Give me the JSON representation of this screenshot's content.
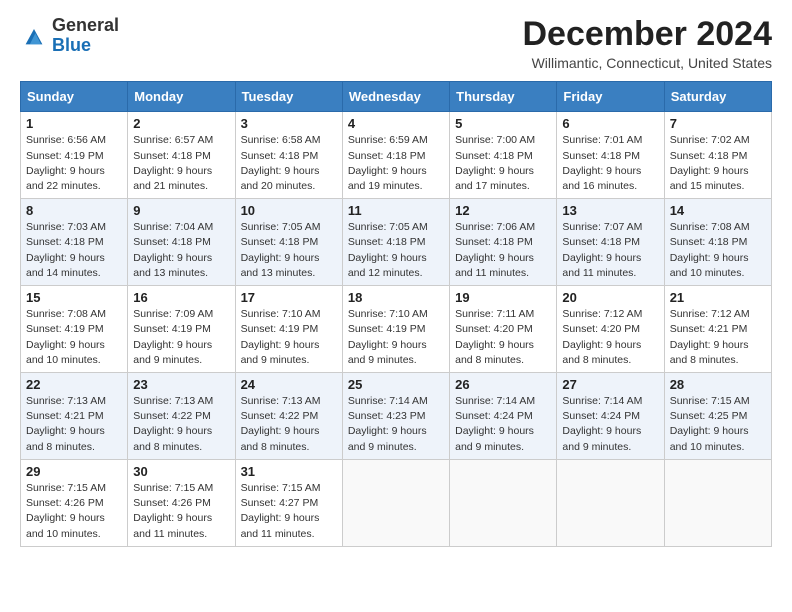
{
  "header": {
    "logo_general": "General",
    "logo_blue": "Blue",
    "month_title": "December 2024",
    "location": "Willimantic, Connecticut, United States"
  },
  "days_of_week": [
    "Sunday",
    "Monday",
    "Tuesday",
    "Wednesday",
    "Thursday",
    "Friday",
    "Saturday"
  ],
  "weeks": [
    [
      {
        "day": 1,
        "sunrise": "6:56 AM",
        "sunset": "4:19 PM",
        "daylight": "9 hours and 22 minutes."
      },
      {
        "day": 2,
        "sunrise": "6:57 AM",
        "sunset": "4:18 PM",
        "daylight": "9 hours and 21 minutes."
      },
      {
        "day": 3,
        "sunrise": "6:58 AM",
        "sunset": "4:18 PM",
        "daylight": "9 hours and 20 minutes."
      },
      {
        "day": 4,
        "sunrise": "6:59 AM",
        "sunset": "4:18 PM",
        "daylight": "9 hours and 19 minutes."
      },
      {
        "day": 5,
        "sunrise": "7:00 AM",
        "sunset": "4:18 PM",
        "daylight": "9 hours and 17 minutes."
      },
      {
        "day": 6,
        "sunrise": "7:01 AM",
        "sunset": "4:18 PM",
        "daylight": "9 hours and 16 minutes."
      },
      {
        "day": 7,
        "sunrise": "7:02 AM",
        "sunset": "4:18 PM",
        "daylight": "9 hours and 15 minutes."
      }
    ],
    [
      {
        "day": 8,
        "sunrise": "7:03 AM",
        "sunset": "4:18 PM",
        "daylight": "9 hours and 14 minutes."
      },
      {
        "day": 9,
        "sunrise": "7:04 AM",
        "sunset": "4:18 PM",
        "daylight": "9 hours and 13 minutes."
      },
      {
        "day": 10,
        "sunrise": "7:05 AM",
        "sunset": "4:18 PM",
        "daylight": "9 hours and 13 minutes."
      },
      {
        "day": 11,
        "sunrise": "7:05 AM",
        "sunset": "4:18 PM",
        "daylight": "9 hours and 12 minutes."
      },
      {
        "day": 12,
        "sunrise": "7:06 AM",
        "sunset": "4:18 PM",
        "daylight": "9 hours and 11 minutes."
      },
      {
        "day": 13,
        "sunrise": "7:07 AM",
        "sunset": "4:18 PM",
        "daylight": "9 hours and 11 minutes."
      },
      {
        "day": 14,
        "sunrise": "7:08 AM",
        "sunset": "4:18 PM",
        "daylight": "9 hours and 10 minutes."
      }
    ],
    [
      {
        "day": 15,
        "sunrise": "7:08 AM",
        "sunset": "4:19 PM",
        "daylight": "9 hours and 10 minutes."
      },
      {
        "day": 16,
        "sunrise": "7:09 AM",
        "sunset": "4:19 PM",
        "daylight": "9 hours and 9 minutes."
      },
      {
        "day": 17,
        "sunrise": "7:10 AM",
        "sunset": "4:19 PM",
        "daylight": "9 hours and 9 minutes."
      },
      {
        "day": 18,
        "sunrise": "7:10 AM",
        "sunset": "4:19 PM",
        "daylight": "9 hours and 9 minutes."
      },
      {
        "day": 19,
        "sunrise": "7:11 AM",
        "sunset": "4:20 PM",
        "daylight": "9 hours and 8 minutes."
      },
      {
        "day": 20,
        "sunrise": "7:12 AM",
        "sunset": "4:20 PM",
        "daylight": "9 hours and 8 minutes."
      },
      {
        "day": 21,
        "sunrise": "7:12 AM",
        "sunset": "4:21 PM",
        "daylight": "9 hours and 8 minutes."
      }
    ],
    [
      {
        "day": 22,
        "sunrise": "7:13 AM",
        "sunset": "4:21 PM",
        "daylight": "9 hours and 8 minutes."
      },
      {
        "day": 23,
        "sunrise": "7:13 AM",
        "sunset": "4:22 PM",
        "daylight": "9 hours and 8 minutes."
      },
      {
        "day": 24,
        "sunrise": "7:13 AM",
        "sunset": "4:22 PM",
        "daylight": "9 hours and 8 minutes."
      },
      {
        "day": 25,
        "sunrise": "7:14 AM",
        "sunset": "4:23 PM",
        "daylight": "9 hours and 9 minutes."
      },
      {
        "day": 26,
        "sunrise": "7:14 AM",
        "sunset": "4:24 PM",
        "daylight": "9 hours and 9 minutes."
      },
      {
        "day": 27,
        "sunrise": "7:14 AM",
        "sunset": "4:24 PM",
        "daylight": "9 hours and 9 minutes."
      },
      {
        "day": 28,
        "sunrise": "7:15 AM",
        "sunset": "4:25 PM",
        "daylight": "9 hours and 10 minutes."
      }
    ],
    [
      {
        "day": 29,
        "sunrise": "7:15 AM",
        "sunset": "4:26 PM",
        "daylight": "9 hours and 10 minutes."
      },
      {
        "day": 30,
        "sunrise": "7:15 AM",
        "sunset": "4:26 PM",
        "daylight": "9 hours and 11 minutes."
      },
      {
        "day": 31,
        "sunrise": "7:15 AM",
        "sunset": "4:27 PM",
        "daylight": "9 hours and 11 minutes."
      },
      null,
      null,
      null,
      null
    ]
  ]
}
